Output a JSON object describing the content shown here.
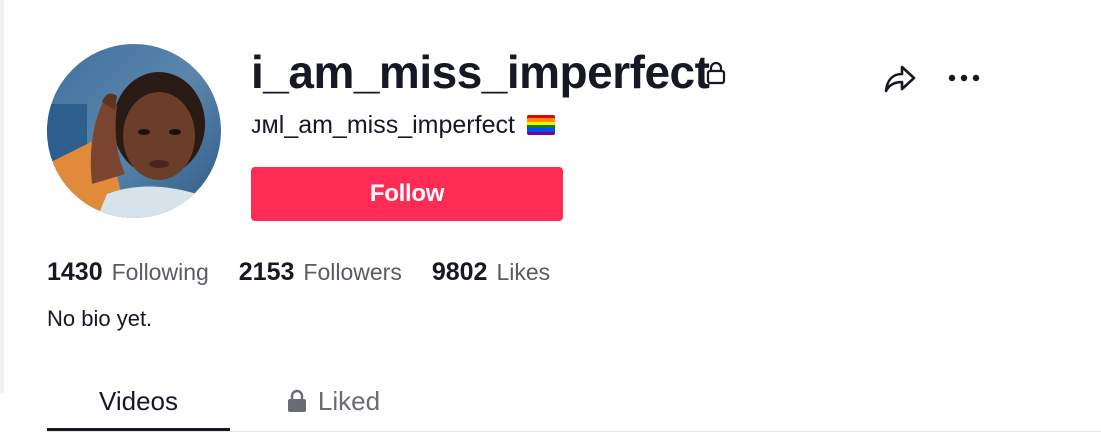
{
  "profile": {
    "username": "i_am_miss_imperfect",
    "nickname": "ᴊᴍl_am_miss_imperfect",
    "private_icon": "lock-icon",
    "flag_icon": "rainbow-flag-icon",
    "follow_label": "Follow",
    "bio": "No bio yet."
  },
  "actions": {
    "share_icon": "share-arrow-icon",
    "more_icon": "more-dots-icon"
  },
  "stats": [
    {
      "value": "1430",
      "label": "Following"
    },
    {
      "value": "2153",
      "label": "Followers"
    },
    {
      "value": "9802",
      "label": "Likes"
    }
  ],
  "tabs": [
    {
      "label": "Videos",
      "active": true
    },
    {
      "label": "Liked",
      "icon": "lock-icon",
      "active": false
    }
  ],
  "colors": {
    "accent": "#fe2c55",
    "text": "#161823",
    "muted": "#5a5b63"
  }
}
